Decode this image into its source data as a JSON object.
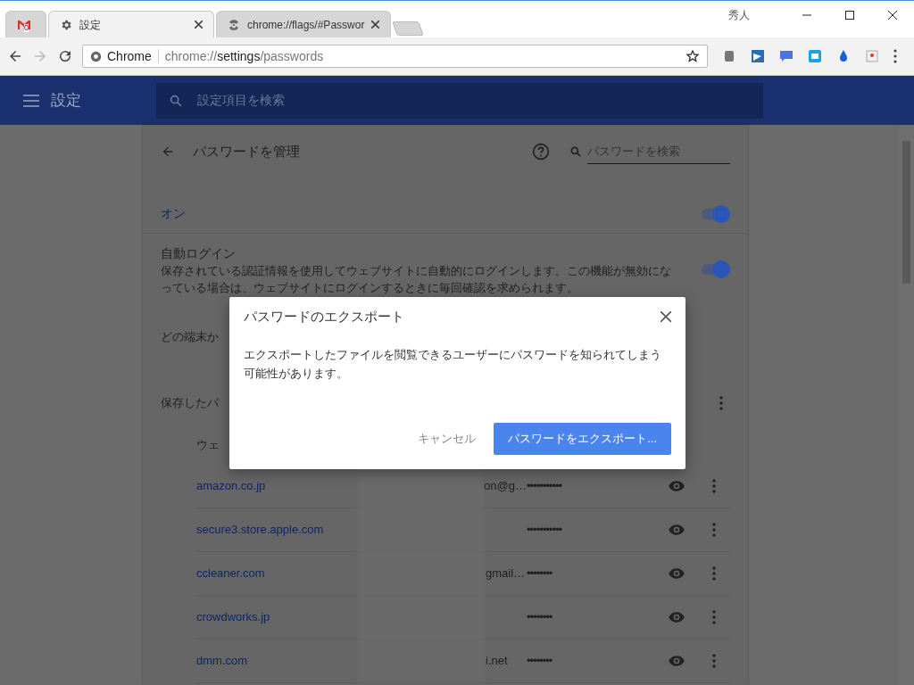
{
  "window": {
    "profile": "秀人"
  },
  "tabs": [
    {
      "kind": "mail",
      "badge": "0",
      "selected": false
    },
    {
      "kind": "settings",
      "title": "設定",
      "selected": true
    },
    {
      "kind": "flags",
      "title": "chrome://flags/#Passwor",
      "selected": false
    }
  ],
  "address_bar": {
    "site": "Chrome",
    "scheme": "chrome://",
    "host": "settings",
    "path": "/passwords"
  },
  "app_header": {
    "title": "設定",
    "search_placeholder": "設定項目を検索"
  },
  "page": {
    "title": "パスワードを管理",
    "search_placeholder": "パスワードを検索",
    "enabled": {
      "label": "オン",
      "on": true
    },
    "auto_login": {
      "title": "自動ログイン",
      "description": "保存されている認証情報を使用してウェブサイトに自動的にログインします。この機能が無効になっている場合は、ウェブサイトにログインするときに毎回確認を求められます。",
      "on": true
    },
    "sync_text": "どの端末か",
    "saved_heading": "保存したパ",
    "column_heading": "ウェ",
    "rows": [
      {
        "site": "amazon.co.jp",
        "username": "on@g…",
        "password": "•••••••••••"
      },
      {
        "site": "secure3.store.apple.com",
        "username": "",
        "password": "•••••••••••"
      },
      {
        "site": "ccleaner.com",
        "username": "gmail…",
        "password": "••••••••"
      },
      {
        "site": "crowdworks.jp",
        "username": "",
        "password": "••••••••"
      },
      {
        "site": "dmm.com",
        "username": "i.net",
        "password": "••••••••"
      }
    ]
  },
  "dialog": {
    "title": "パスワードのエクスポート",
    "body": "エクスポートしたファイルを閲覧できるユーザーにパスワードを知られてしまう可能性があります。",
    "cancel": "キャンセル",
    "confirm": "パスワードをエクスポート..."
  }
}
